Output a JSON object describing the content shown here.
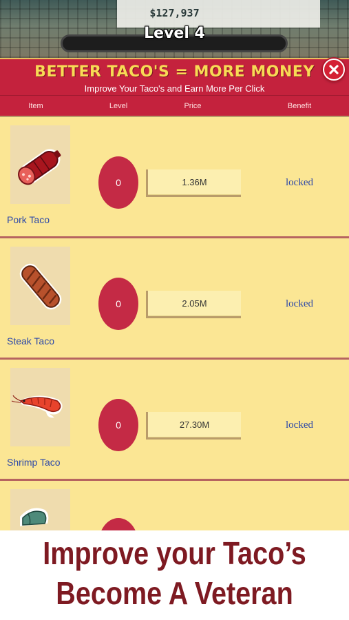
{
  "header": {
    "money": "$127,937",
    "level": "Level 4"
  },
  "dialog": {
    "title": "BETTER TACO'S = MORE MONEY",
    "subtitle": "Improve Your Taco's and Earn More Per Click",
    "close_icon": "close-x-icon",
    "columns": [
      "Item",
      "Level",
      "Price",
      "Benefit"
    ]
  },
  "items": [
    {
      "name": "Pork Taco",
      "level": "0",
      "price": "1.36M",
      "benefit": "locked",
      "icon": "salami-icon"
    },
    {
      "name": "Steak Taco",
      "level": "0",
      "price": "2.05M",
      "benefit": "locked",
      "icon": "steak-icon"
    },
    {
      "name": "Shrimp Taco",
      "level": "0",
      "price": "27.30M",
      "benefit": "locked",
      "icon": "shrimp-icon"
    },
    {
      "name": "",
      "level": "",
      "price": "",
      "benefit": "",
      "icon": "fish-icon"
    }
  ],
  "promo": {
    "line1": "Improve your Taco’s",
    "line2": "Become A Veteran"
  },
  "colors": {
    "header_red": "#c4223d",
    "title_yellow": "#f8da55",
    "list_bg": "#fbe694",
    "link_blue": "#2c48a8",
    "promo_text": "#7e1a22"
  }
}
